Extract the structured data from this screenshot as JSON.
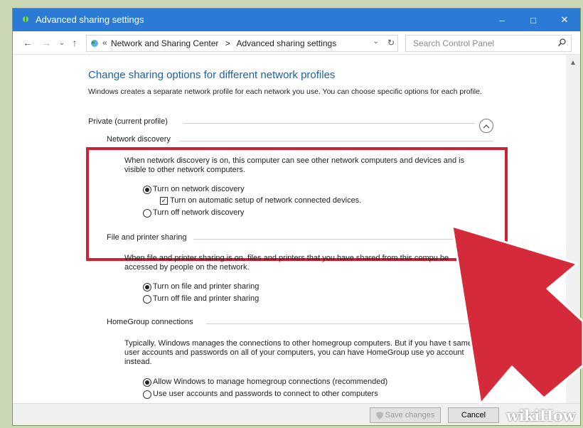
{
  "window": {
    "title": "Advanced sharing settings",
    "buttons": {
      "minimize": "–",
      "maximize": "□",
      "close": "✕"
    }
  },
  "address_bar": {
    "back": "←",
    "forward": "→",
    "recent": "⌄",
    "up": "↑",
    "overflow": "«",
    "breadcrumb_1": "Network and Sharing Center",
    "separator": ">",
    "breadcrumb_2": "Advanced sharing settings",
    "dropdown": "⌄",
    "refresh": "↻",
    "search_placeholder": "Search Control Panel"
  },
  "page": {
    "heading": "Change sharing options for different network profiles",
    "description": "Windows creates a separate network profile for each network you use. You can choose specific options for each profile."
  },
  "profile": {
    "label": "Private (current profile)"
  },
  "network_discovery": {
    "label": "Network discovery",
    "description": "When network discovery is on, this computer can see other network computers and devices and is visible to other network computers.",
    "turn_on": "Turn on network discovery",
    "auto_setup": "Turn on automatic setup of network connected devices.",
    "turn_off": "Turn off network discovery"
  },
  "file_printer": {
    "label": "File and printer sharing",
    "description": "When file and printer sharing is on, files and printers that you have shared from this compu be accessed by people on the network.",
    "turn_on": "Turn on file and printer sharing",
    "turn_off": "Turn off file and printer sharing"
  },
  "homegroup": {
    "label": "HomeGroup connections",
    "description": "Typically, Windows manages the connections to other homegroup computers. But if you have t same user accounts and passwords on all of your computers, you can have HomeGroup use yo account instead.",
    "allow": "Allow Windows to manage homegroup connections (recommended)",
    "use_accounts": "Use user accounts and passwords to connect to other computers"
  },
  "footer": {
    "save": "Save changes",
    "cancel": "Cancel"
  },
  "watermark": "wikiHow",
  "colors": {
    "titlebar": "#2b7bd6",
    "heading": "#1e5fa8",
    "highlight": "#cc2233"
  }
}
